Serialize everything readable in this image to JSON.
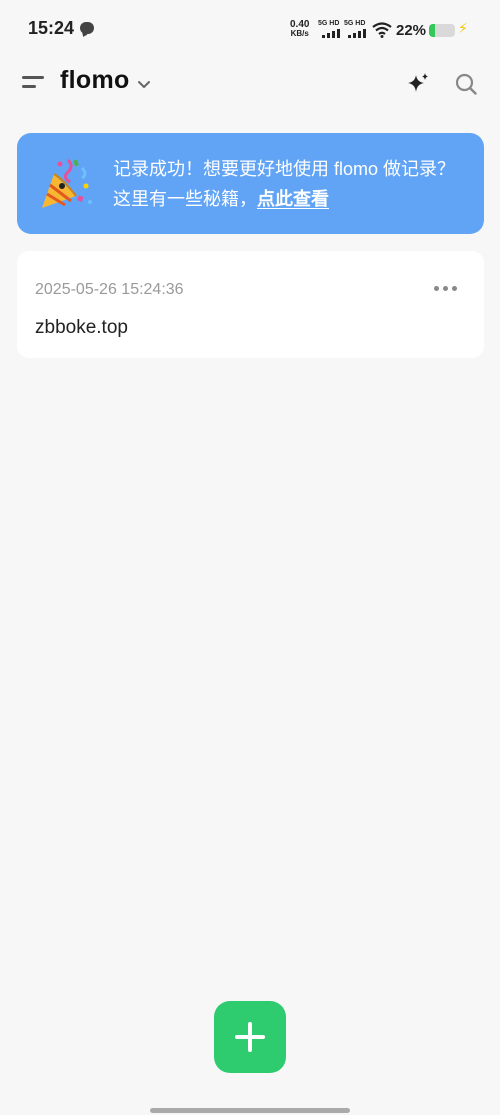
{
  "status_bar": {
    "time": "15:24",
    "net_speed": "0.40",
    "net_speed_unit": "KB/s",
    "sim1_label": "5G HD",
    "sim2_label": "5G HD",
    "battery_percent": "22%",
    "battery_level": 0.22,
    "battery_color": "#34c759"
  },
  "header": {
    "title": "flomo",
    "icons": [
      "menu-icon",
      "chevron-down-icon",
      "sparkle-icon",
      "search-icon"
    ]
  },
  "banner": {
    "text": "记录成功！想要更好地使用 flomo 做记录？这里有一些秘籍，",
    "link_text": "点此查看",
    "icon": "party-popper-icon",
    "bg_color": "#61a4f5"
  },
  "memo": {
    "timestamp": "2025-05-26 15:24:36",
    "content": "zbboke.top",
    "more_icon": "more-icon"
  },
  "fab": {
    "icon": "plus-icon",
    "color": "#2ecb6f"
  }
}
